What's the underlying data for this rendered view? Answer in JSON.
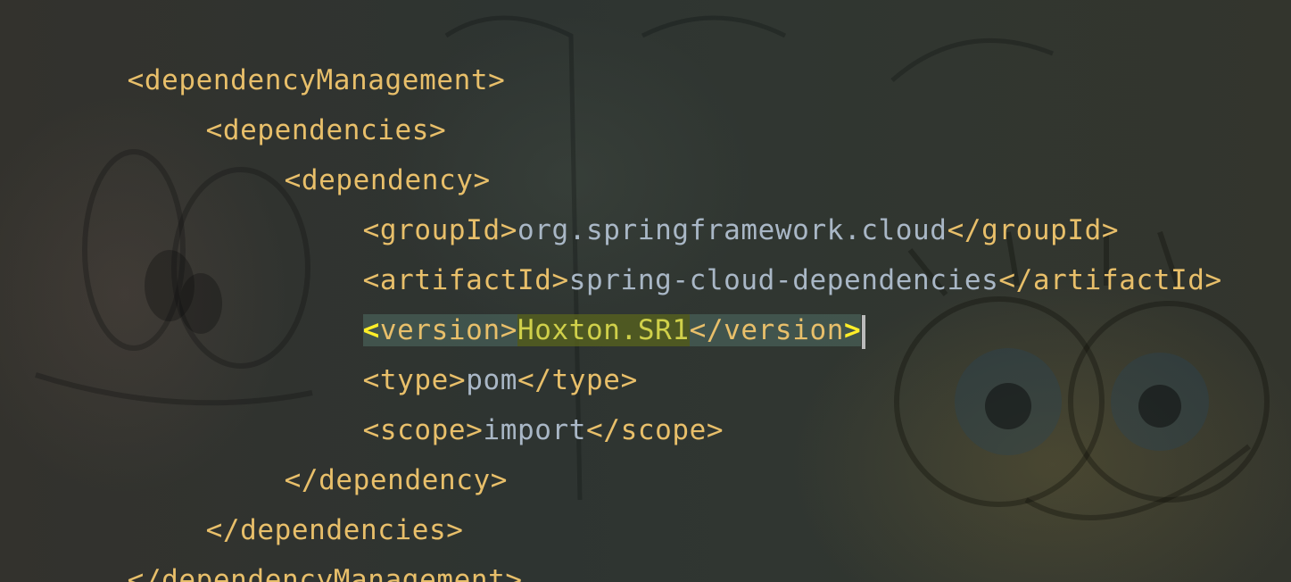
{
  "editor": {
    "language": "xml",
    "lines": [
      {
        "indent": 0,
        "open": "<dependencyManagement>",
        "value": "",
        "close": ""
      },
      {
        "indent": 1,
        "open": "<dependencies>",
        "value": "",
        "close": ""
      },
      {
        "indent": 2,
        "open": "<dependency>",
        "value": "",
        "close": ""
      },
      {
        "indent": 3,
        "open": "<groupId>",
        "value": "org.springframework.cloud",
        "close": "</groupId>"
      },
      {
        "indent": 3,
        "open": "<artifactId>",
        "value": "spring-cloud-dependencies",
        "close": "</artifactId>"
      },
      {
        "indent": 3,
        "open": "<version>",
        "value": "Hoxton.SR1",
        "close": "</version>"
      },
      {
        "indent": 3,
        "open": "<type>",
        "value": "pom",
        "close": "</type>"
      },
      {
        "indent": 3,
        "open": "<scope>",
        "value": "import",
        "close": "</scope>"
      },
      {
        "indent": 2,
        "open": "</dependency>",
        "value": "",
        "close": ""
      },
      {
        "indent": 1,
        "open": "</dependencies>",
        "value": "",
        "close": ""
      },
      {
        "indent": 0,
        "open": "</dependencyManagement>",
        "value": "",
        "close": ""
      }
    ],
    "current_line": 6,
    "colors": {
      "tag": "#e8bf6a",
      "text": "#a9b7c6",
      "bracket_match": "#ffef28",
      "value_highlight": "#5a641e",
      "tag_highlight": "#506e64"
    }
  }
}
